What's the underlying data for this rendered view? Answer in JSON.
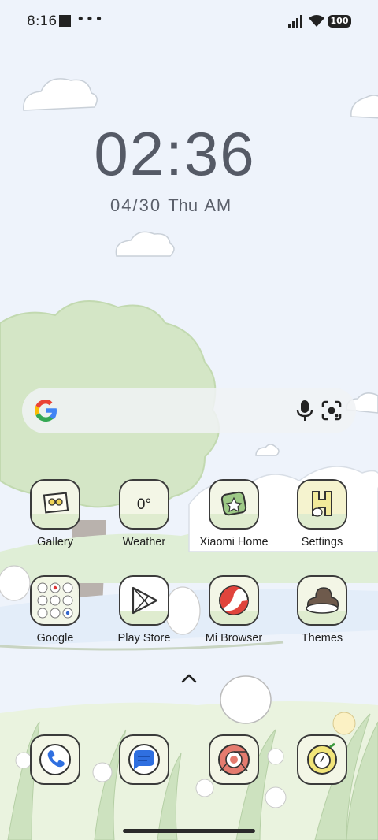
{
  "status_bar": {
    "time": "8:16",
    "battery": "100"
  },
  "lockclock": {
    "time": "02:36",
    "date": "04/30",
    "weekday": "Thu",
    "ampm": "AM"
  },
  "search": {
    "provider": "Google",
    "icons": [
      "google-logo-icon",
      "mic-icon",
      "lens-icon"
    ]
  },
  "apps": [
    {
      "label": "Gallery",
      "icon": "gallery-icon"
    },
    {
      "label": "Weather",
      "icon": "weather-icon",
      "value": "0°"
    },
    {
      "label": "Xiaomi Home",
      "icon": "xiaomi-home-icon"
    },
    {
      "label": "Settings",
      "icon": "settings-icon"
    },
    {
      "label": "Google",
      "icon": "google-folder-icon"
    },
    {
      "label": "Play Store",
      "icon": "play-store-icon"
    },
    {
      "label": "Mi Browser",
      "icon": "mi-browser-icon"
    },
    {
      "label": "Themes",
      "icon": "themes-icon"
    }
  ],
  "dock": [
    {
      "icon": "phone-icon"
    },
    {
      "icon": "messages-icon"
    },
    {
      "icon": "chrome-icon"
    },
    {
      "icon": "camera-icon"
    }
  ],
  "colors": {
    "background": "#eef3fb",
    "tree": "#cfe3c1",
    "icon_bg": "#f3f6e6",
    "icon_border": "#3b3b3b",
    "text": "#1f1f1f"
  }
}
